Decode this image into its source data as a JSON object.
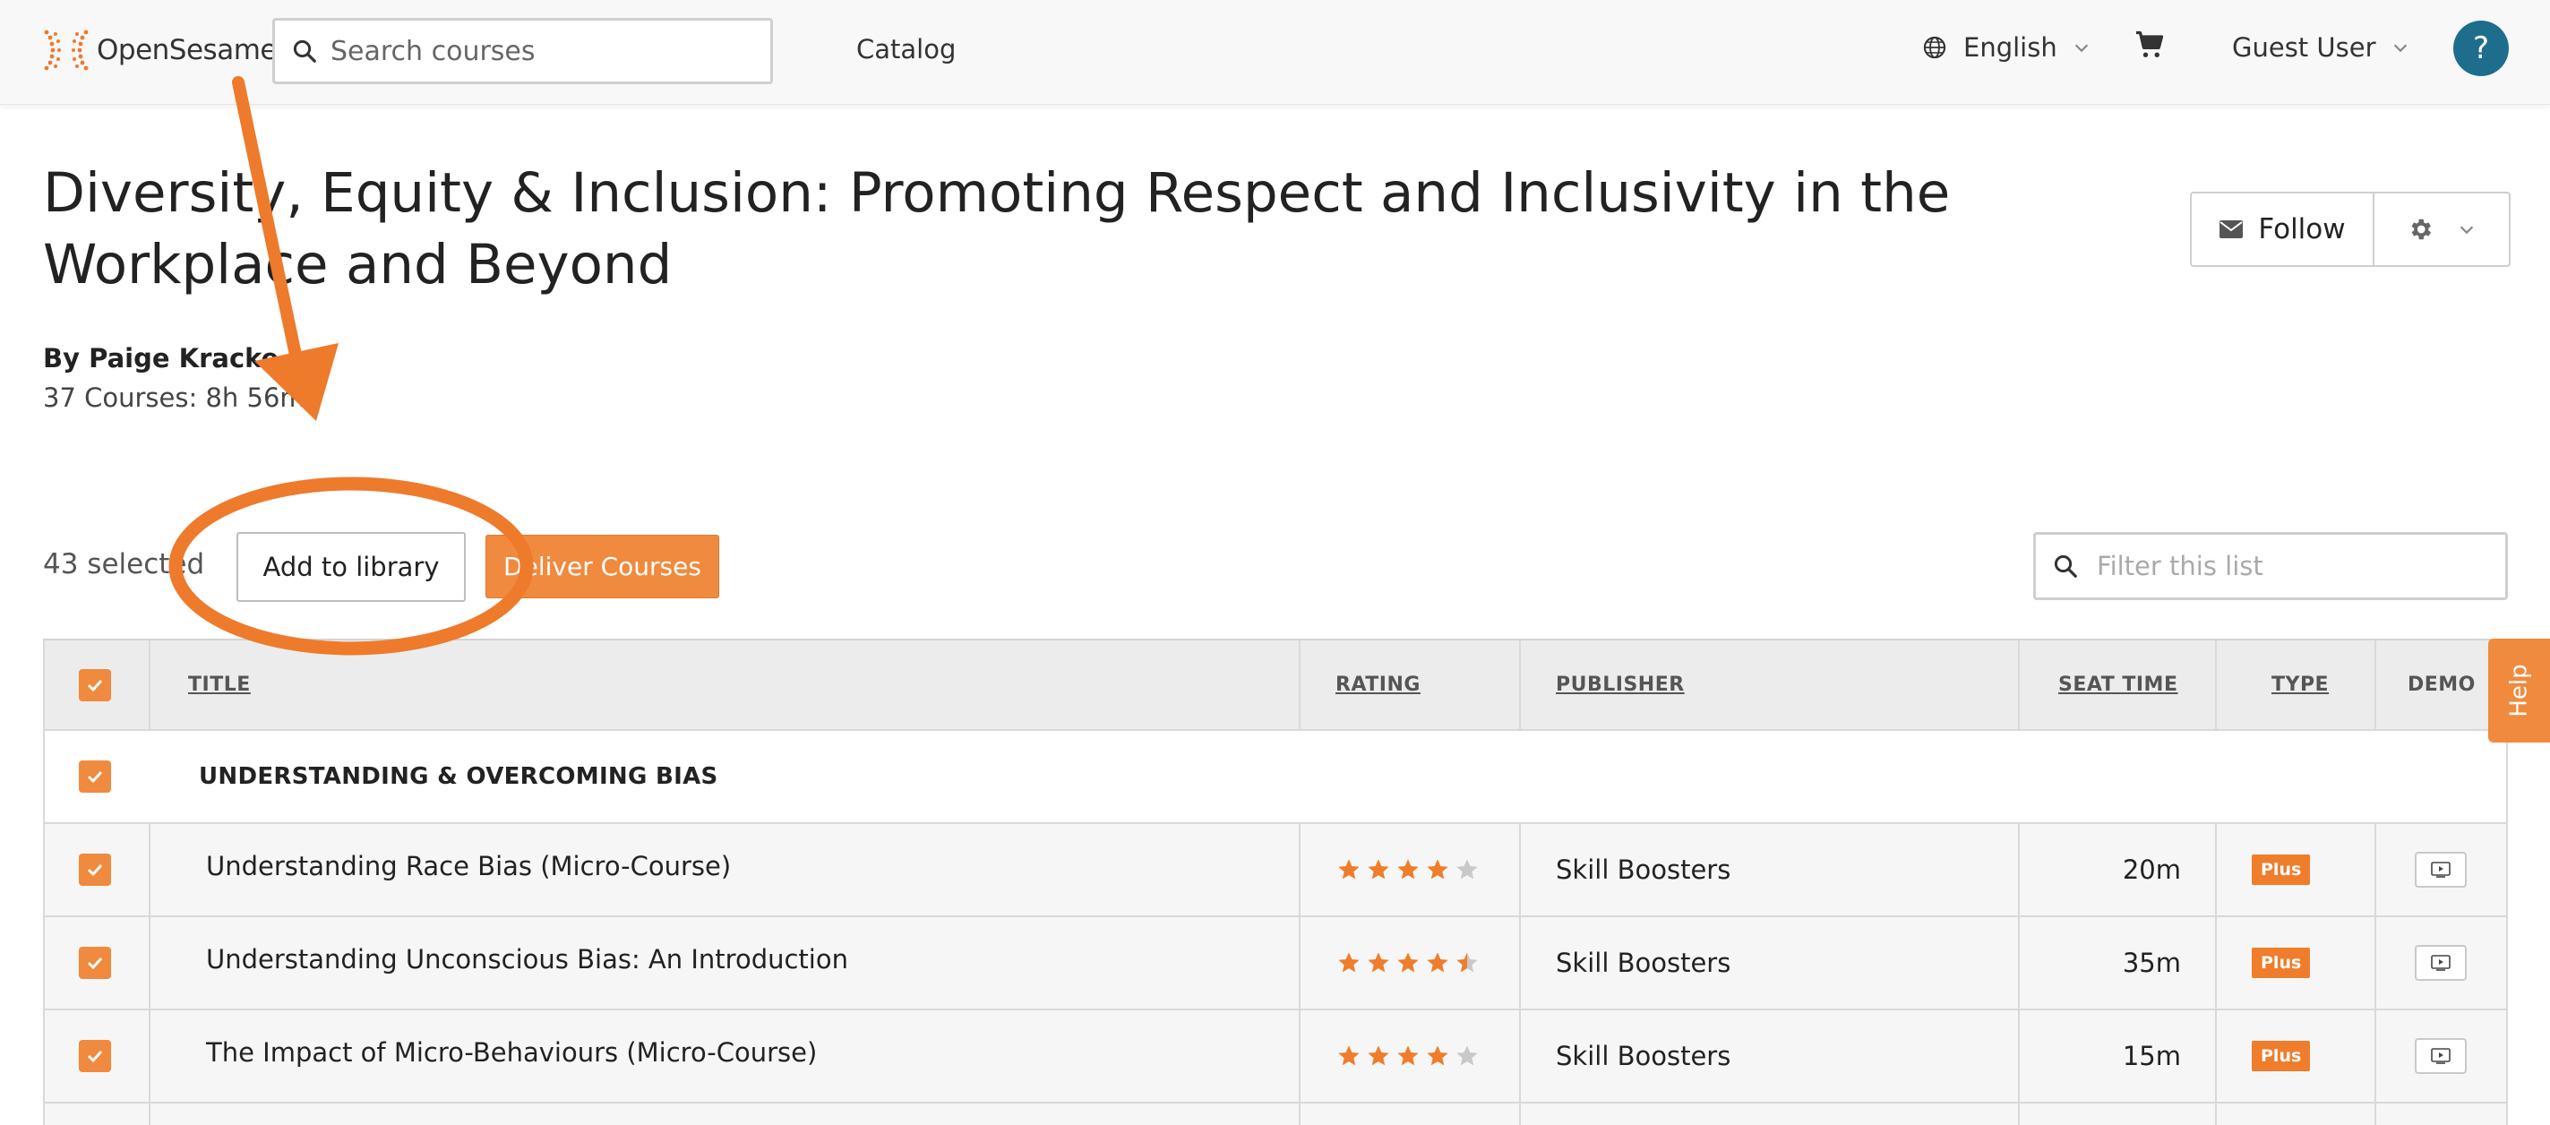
{
  "header": {
    "logo_text": "OpenSesame",
    "search_placeholder": "Search courses",
    "nav_catalog": "Catalog",
    "language": "English",
    "user": "Guest User",
    "help_glyph": "?"
  },
  "page": {
    "title": "Diversity, Equity & Inclusion: Promoting Respect and Inclusivity in the Workplace and Beyond",
    "author": "By Paige Kracke",
    "meta": "37 Courses: 8h 56m",
    "follow_label": "Follow"
  },
  "actions": {
    "selected_count": "43 selected",
    "add_to_library": "Add to library",
    "deliver_courses": "Deliver Courses",
    "filter_placeholder": "Filter this list"
  },
  "table": {
    "columns": [
      "TITLE",
      "RATING",
      "PUBLISHER",
      "SEAT TIME",
      "TYPE",
      "DEMO"
    ],
    "group": "UNDERSTANDING & OVERCOMING BIAS",
    "rows": [
      {
        "title": "Understanding Race Bias (Micro-Course)",
        "rating": 4,
        "publisher": "Skill Boosters",
        "seat_time": "20m",
        "type": "Plus"
      },
      {
        "title": "Understanding Unconscious Bias: An Introduction",
        "rating": 4.5,
        "publisher": "Skill Boosters",
        "seat_time": "35m",
        "type": "Plus"
      },
      {
        "title": "The Impact of Micro-Behaviours (Micro-Course)",
        "rating": 4,
        "publisher": "Skill Boosters",
        "seat_time": "15m",
        "type": "Plus"
      }
    ]
  },
  "side_tab": {
    "label": "Help"
  },
  "colors": {
    "accent_orange": "#f08a3e",
    "help_blue": "#1f6d8c",
    "annotation_orange": "#ee7a2c"
  },
  "icons": [
    "opensesame-logo-icon",
    "search-icon",
    "globe-icon",
    "chevron-down-icon",
    "cart-icon",
    "mail-icon",
    "gear-icon",
    "check-icon",
    "star-icon",
    "play-icon"
  ]
}
